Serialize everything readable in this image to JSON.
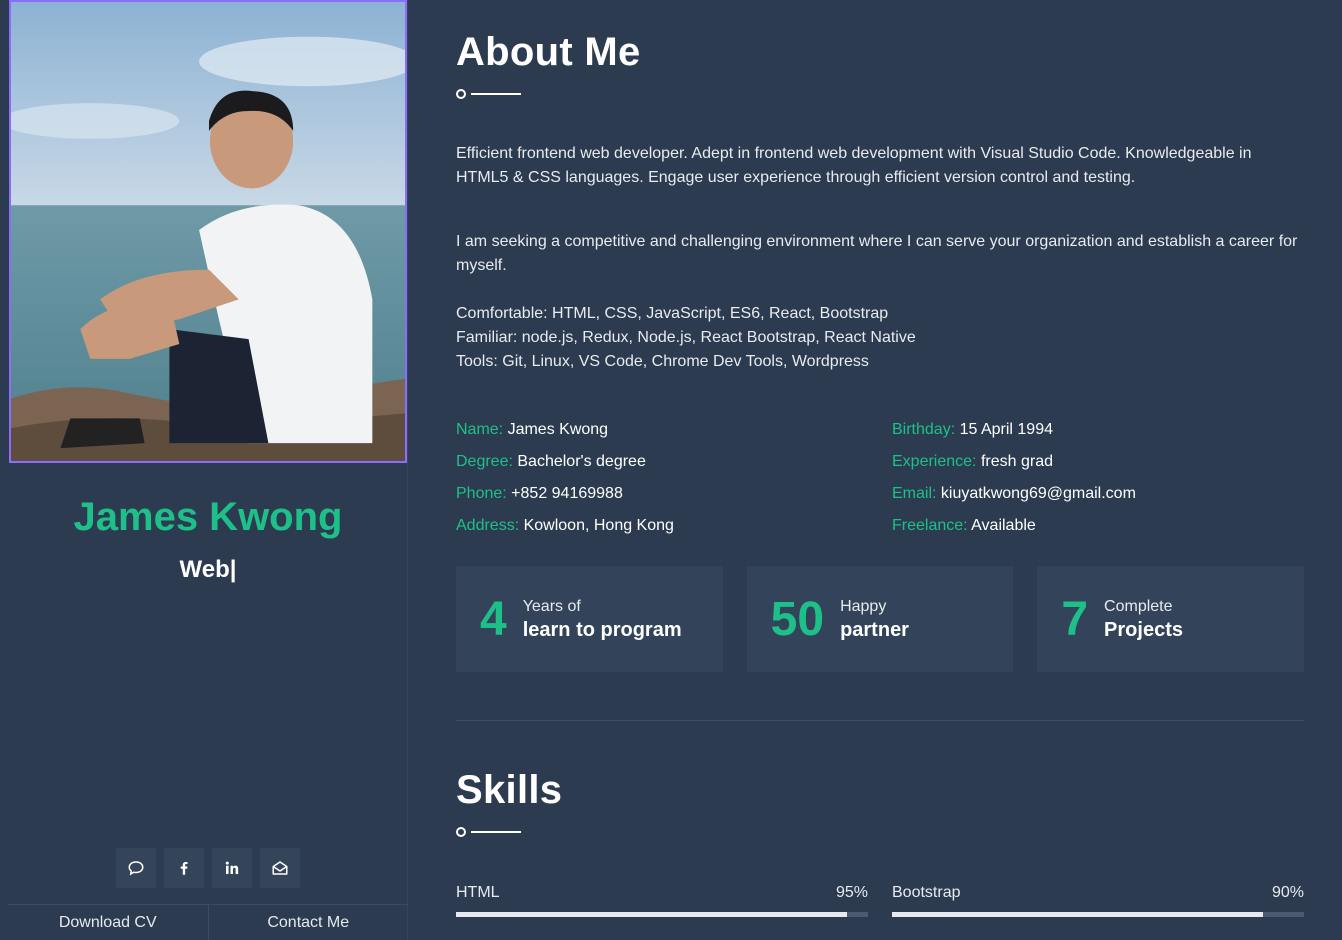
{
  "profile": {
    "name": "James Kwong",
    "role": "Web|"
  },
  "sidebar": {
    "socials": [
      "chat-icon",
      "facebook-icon",
      "linkedin-icon",
      "mail-icon"
    ],
    "download_label": "Download CV",
    "contact_label": "Contact Me"
  },
  "about": {
    "title": "About Me",
    "paragraph1": "Efficient frontend web developer. Adept in frontend web development with Visual Studio Code. Knowledgeable in HTML5 & CSS languages. Engage user experience through efficient version control and testing.",
    "paragraph2": "I am seeking a competitive and challenging environment where I can serve your organization and establish a career for myself.",
    "comfortable": "Comfortable: HTML, CSS, JavaScript, ES6, React, Bootstrap",
    "familiar": "Familiar: node.js, Redux, Node.js, React Bootstrap, React Native",
    "tools": "Tools: Git, Linux, VS Code, Chrome Dev Tools, Wordpress"
  },
  "info": [
    {
      "key": "Name:",
      "value": "James Kwong"
    },
    {
      "key": "Birthday:",
      "value": "15 April 1994"
    },
    {
      "key": "Degree:",
      "value": "Bachelor's degree"
    },
    {
      "key": "Experience:",
      "value": "fresh grad"
    },
    {
      "key": "Phone:",
      "value": "+852 94169988"
    },
    {
      "key": "Email:",
      "value": "kiuyatkwong69@gmail.com"
    },
    {
      "key": "Address:",
      "value": "Kowloon, Hong Kong"
    },
    {
      "key": "Freelance:",
      "value": "Available"
    }
  ],
  "stats": [
    {
      "number": "4",
      "line1": "Years of",
      "line2": "learn to program"
    },
    {
      "number": "50",
      "line1": "Happy",
      "line2": "partner"
    },
    {
      "number": "7",
      "line1": "Complete",
      "line2": "Projects"
    }
  ],
  "skills": {
    "title": "Skills",
    "items": [
      {
        "name": "HTML",
        "percent_label": "95%",
        "percent": 95
      },
      {
        "name": "Bootstrap",
        "percent_label": "90%",
        "percent": 90
      }
    ]
  },
  "colors": {
    "accent": "#1ec08a",
    "background": "#2c3b4f",
    "card": "#33445a",
    "photo_border": "#8a6cff"
  }
}
